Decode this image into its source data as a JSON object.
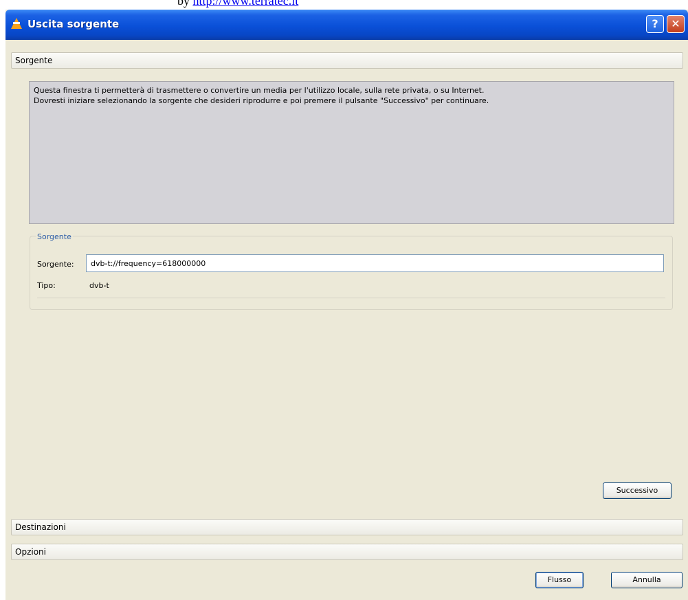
{
  "banner": {
    "prefix": "by ",
    "link": "http://www.terratec.it"
  },
  "window": {
    "title": "Uscita sorgente",
    "help_label": "?",
    "close_label": "✕"
  },
  "sections": {
    "sorgente": "Sorgente",
    "destinazioni": "Destinazioni",
    "opzioni": "Opzioni"
  },
  "info": {
    "line1": "Questa finestra ti permetterà di trasmettere o convertire un media per l'utilizzo locale, sulla rete privata, o su Internet.",
    "line2": "Dovresti iniziare selezionando la sorgente che desideri riprodurre e poi premere il pulsante \"Successivo\" per continuare."
  },
  "source_group": {
    "legend": "Sorgente",
    "source_label": "Sorgente:",
    "source_value": "dvb-t://frequency=618000000",
    "type_label": "Tipo:",
    "type_value": "dvb-t"
  },
  "buttons": {
    "successivo": "Successivo",
    "flusso": "Flusso",
    "annulla": "Annulla"
  },
  "icons": {
    "app": "vlc-cone-icon",
    "help": "help-icon",
    "close": "close-icon"
  },
  "colors": {
    "titlebar": "#0a50d8",
    "info_background": "#d4d3d8",
    "dialog_background": "#ece9d8",
    "legend_text": "#2e5ea7"
  }
}
